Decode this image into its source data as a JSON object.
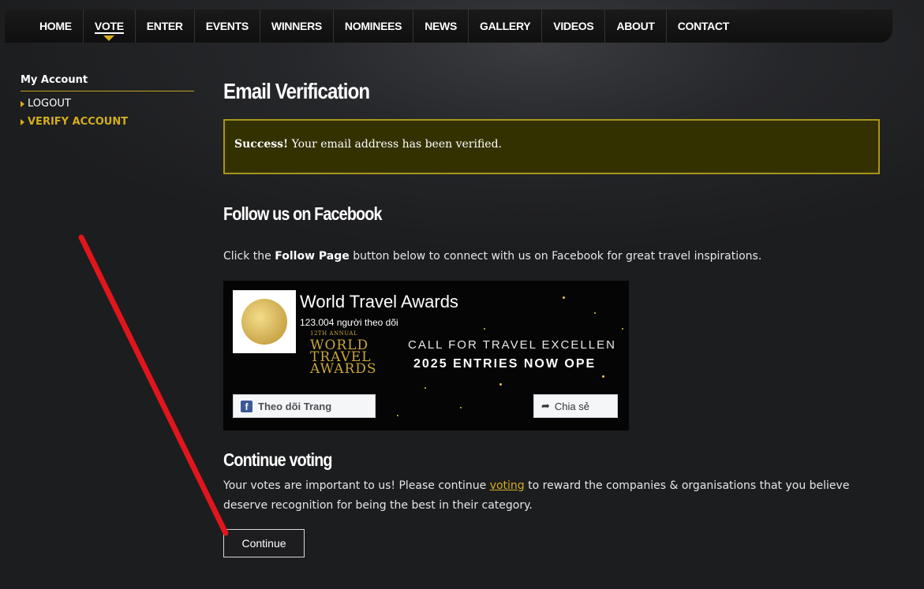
{
  "nav": {
    "items": [
      "HOME",
      "VOTE",
      "ENTER",
      "EVENTS",
      "WINNERS",
      "NOMINEES",
      "NEWS",
      "GALLERY",
      "VIDEOS",
      "ABOUT",
      "CONTACT"
    ],
    "active": "VOTE"
  },
  "sidebar": {
    "heading": "My Account",
    "links": [
      "LOGOUT",
      "VERIFY ACCOUNT"
    ]
  },
  "main": {
    "title": "Email Verification",
    "alert": {
      "strong": "Success!",
      "text": " Your email address has been verified."
    },
    "follow": {
      "heading": "Follow us on Facebook",
      "text_before": "Click the ",
      "text_bold": "Follow Page",
      "text_after": " button below to connect with us on Facebook for great travel inspirations."
    },
    "facebook_widget": {
      "page_name": "World Travel Awards",
      "followers": "123.004 người theo dõi",
      "banner_small": "12TH ANNUAL",
      "banner_line1": "WORLD",
      "banner_line2": "TRAVEL",
      "banner_line3": "AWARDS",
      "call_text": "CALL FOR TRAVEL EXCELLEN",
      "entries_text": "2025 ENTRIES NOW OPE",
      "follow_label": "Theo dõi Trang",
      "share_label": "Chia sẻ"
    },
    "continue": {
      "heading": "Continue voting",
      "text_before": "Your votes are important to us! Please continue ",
      "link": "voting",
      "text_after": " to reward the companies & organisations that you believe deserve recognition for being the best in their category.",
      "button": "Continue"
    }
  },
  "colors": {
    "accent_gold": "#d4ae1c",
    "alert_bg": "#343100",
    "annotation_red": "#e0161c"
  }
}
